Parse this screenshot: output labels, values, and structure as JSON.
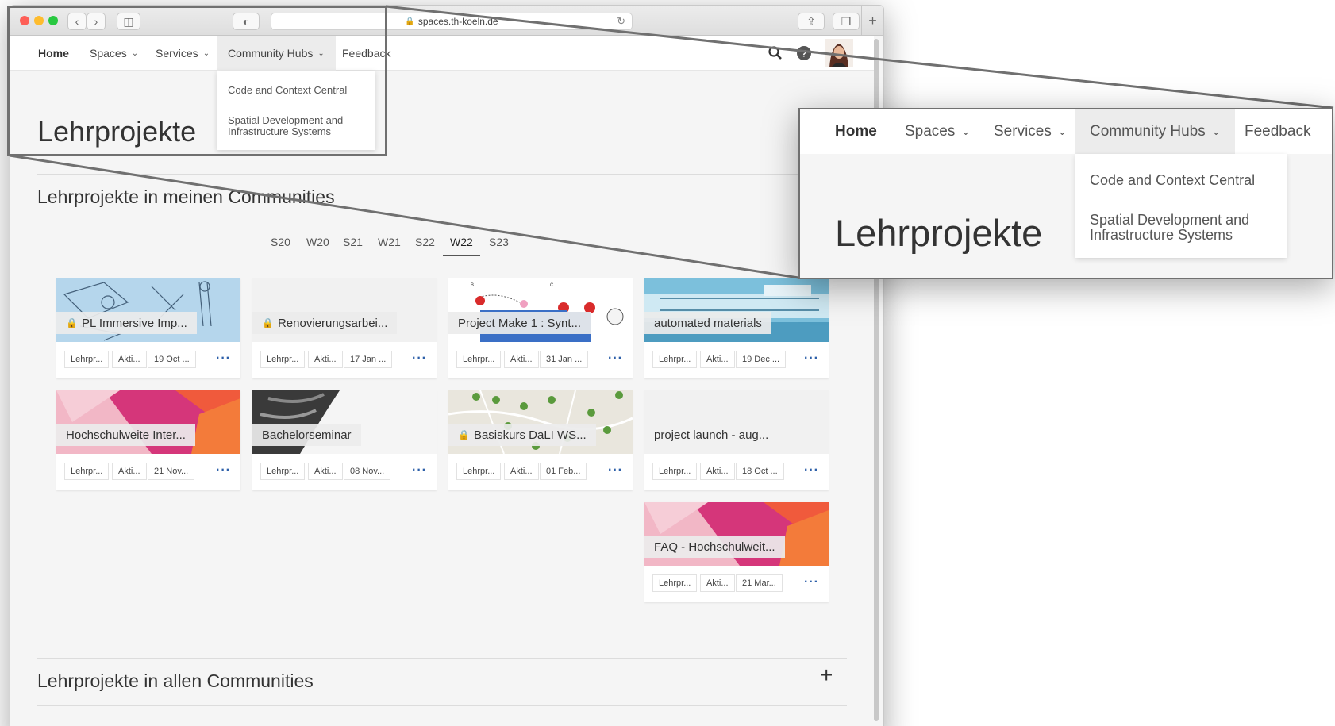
{
  "browser": {
    "url": "spaces.th-koeln.de"
  },
  "nav": {
    "home": "Home",
    "spaces": "Spaces",
    "services": "Services",
    "community_hubs": "Community Hubs",
    "feedback": "Feedback"
  },
  "dropdown": {
    "item1": "Code and Context Central",
    "item2_line1": "Spatial Development and",
    "item2_line2": "Infrastructure Systems"
  },
  "page": {
    "title": "Lehrprojekte",
    "section_my": "Lehrprojekte in meinen Communities",
    "section_all": "Lehrprojekte in allen Communities"
  },
  "semesters": [
    "S20",
    "W20",
    "S21",
    "W21",
    "S22",
    "W22",
    "S23"
  ],
  "active_semester": "W22",
  "cards": [
    {
      "title": "PL Immersive Imp...",
      "locked": true,
      "type": "Lehrpr...",
      "status": "Akti...",
      "date": "19 Oct ..."
    },
    {
      "title": "Renovierungsarbei...",
      "locked": true,
      "type": "Lehrpr...",
      "status": "Akti...",
      "date": "17 Jan ..."
    },
    {
      "title": "Project Make 1 : Synt...",
      "locked": false,
      "type": "Lehrpr...",
      "status": "Akti...",
      "date": "31 Jan ..."
    },
    {
      "title": "automated materials",
      "locked": false,
      "type": "Lehrpr...",
      "status": "Akti...",
      "date": "19 Dec ..."
    },
    {
      "title": "Hochschulweite Inter...",
      "locked": false,
      "type": "Lehrpr...",
      "status": "Akti...",
      "date": "21 Nov..."
    },
    {
      "title": "Bachelorseminar",
      "locked": false,
      "type": "Lehrpr...",
      "status": "Akti...",
      "date": "08 Nov..."
    },
    {
      "title": "Basiskurs DaLI WS...",
      "locked": true,
      "type": "Lehrpr...",
      "status": "Akti...",
      "date": "01 Feb..."
    },
    {
      "title": "project launch - aug...",
      "locked": false,
      "type": "Lehrpr...",
      "status": "Akti...",
      "date": "18 Oct ..."
    },
    {
      "title": "FAQ - Hochschulweit...",
      "locked": false,
      "type": "Lehrpr...",
      "status": "Akti...",
      "date": "21 Mar..."
    }
  ],
  "icons": {
    "search": "search-icon",
    "help": "help-icon",
    "avatar": "avatar",
    "lock": "lock-icon",
    "more": "more-icon",
    "expand": "plus-icon"
  },
  "colors": {
    "accent_blue": "#2b5ea8",
    "hub_pink": "#d5367a",
    "hub_orange": "#f05a3c"
  }
}
